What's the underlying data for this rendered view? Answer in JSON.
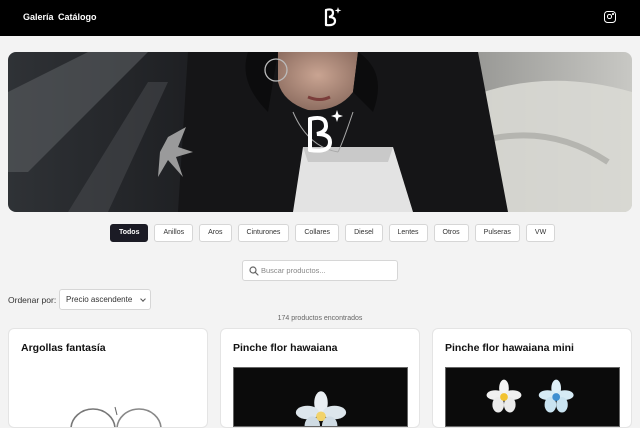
{
  "header": {
    "nav": [
      "Galería",
      "Catálogo"
    ],
    "logo_icon": "b-star-logo-icon",
    "social_icon": "instagram-icon"
  },
  "hero": {
    "image": "banner photo of a woman in black jacket with B logo overlay",
    "logo_icon": "b-star-logo-icon"
  },
  "filters": {
    "chips": [
      "Todos",
      "Anillos",
      "Aros",
      "Cinturones",
      "Collares",
      "Diesel",
      "Lentes",
      "Otros",
      "Pulseras",
      "VW"
    ],
    "active": "Todos",
    "active_color": "#1b1b25"
  },
  "search": {
    "placeholder": "Buscar productos...",
    "value": "",
    "icon": "search-icon"
  },
  "sort": {
    "label": "Ordenar por:",
    "selected": "Precio ascendente"
  },
  "results": {
    "count_text": "174 productos encontrados"
  },
  "products": [
    {
      "title": "Argollas fantasía"
    },
    {
      "title": "Pinche flor hawaiana"
    },
    {
      "title": "Pinche flor hawaiana mini"
    }
  ]
}
